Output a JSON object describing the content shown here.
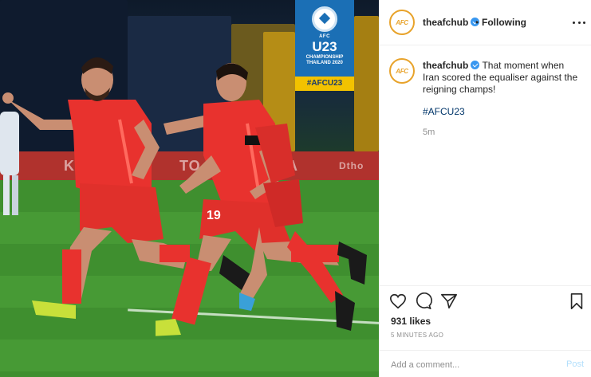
{
  "media": {
    "badge": {
      "org": "AFC",
      "title": "U23",
      "subtitle_line1": "CHAMPIONSHIP",
      "subtitle_line2": "THAILAND 2020",
      "hashtag": "#AFCU23"
    },
    "adboard": [
      "KIR",
      "TO",
      "A",
      "Dtho"
    ],
    "jersey_numbers": [
      "19"
    ]
  },
  "header": {
    "avatar_text": "AFC",
    "username": "theafchub",
    "separator": "•",
    "follow_state": "Following"
  },
  "caption": {
    "avatar_text": "AFC",
    "username": "theafchub",
    "text": "That moment when Iran scored the equaliser against the reigning champs!",
    "hashtag": "#AFCU23",
    "time": "5m"
  },
  "actions": {
    "likes": "931 likes",
    "posted_ago": "5 MINUTES AGO"
  },
  "comment": {
    "placeholder": "Add a comment...",
    "post_label": "Post"
  },
  "colors": {
    "accent_blue": "#3897f0",
    "hashtag_link": "#003569",
    "post_disabled": "#b2dffc",
    "jersey_red": "#e8322e",
    "badge_blue": "#1b6fb5",
    "badge_yellow": "#f2c200"
  },
  "icons": [
    "verified-icon",
    "more-icon",
    "heart-icon",
    "comment-icon",
    "share-icon",
    "bookmark-icon"
  ]
}
